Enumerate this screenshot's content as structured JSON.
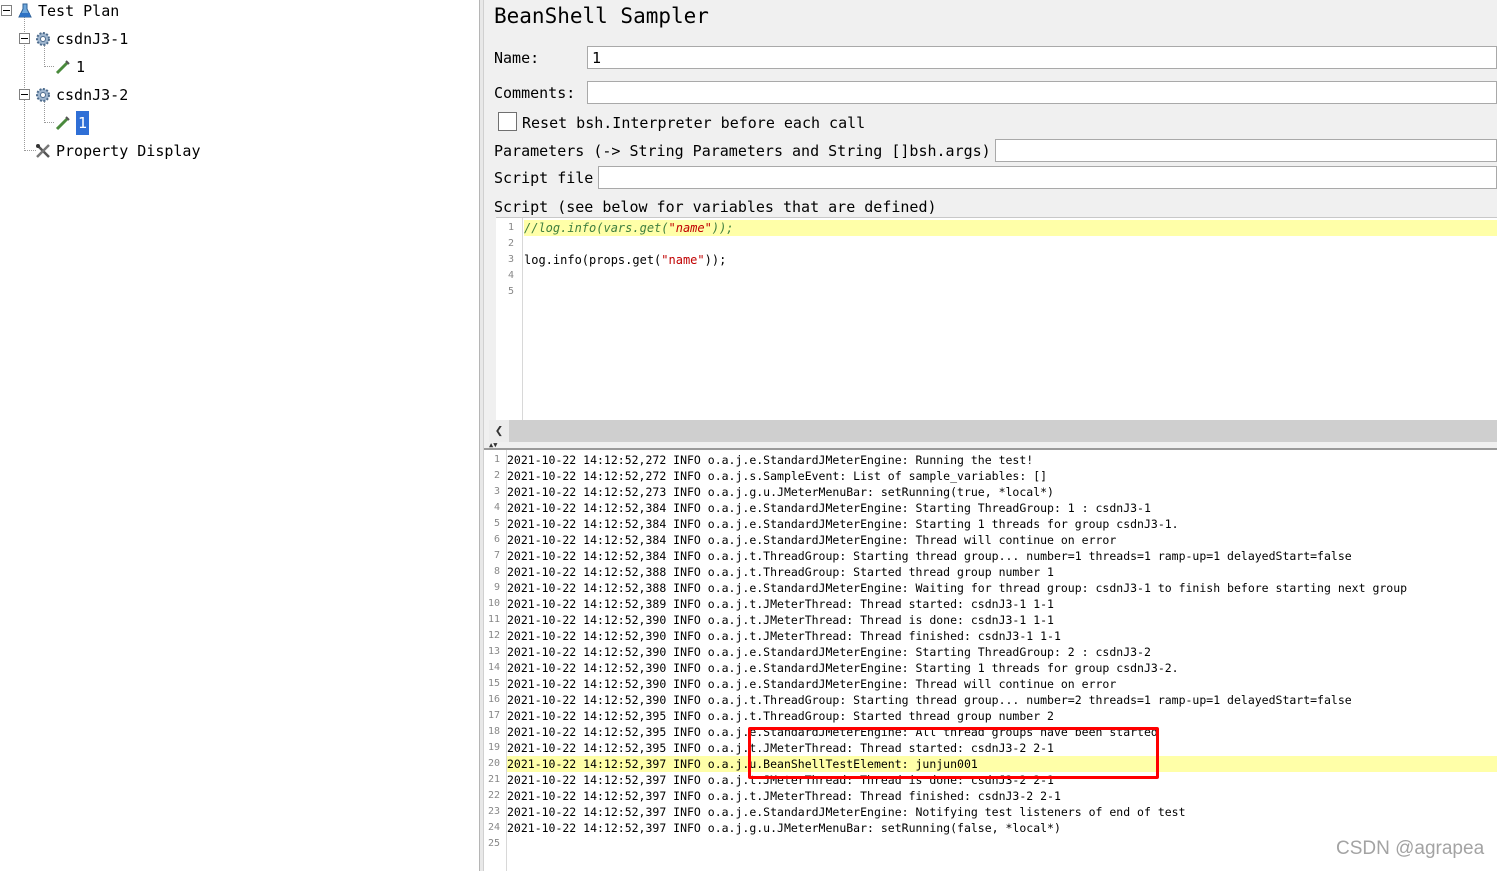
{
  "tree": {
    "nodes": [
      {
        "label": "Test Plan",
        "icon": "test-plan-icon"
      },
      {
        "label": "csdnJ3-1",
        "icon": "thread-group-gear-icon"
      },
      {
        "label": "1",
        "icon": "beanshell-sampler-icon"
      },
      {
        "label": "csdnJ3-2",
        "icon": "thread-group-gear-icon"
      },
      {
        "label": "1",
        "icon": "beanshell-sampler-icon"
      },
      {
        "label": "Property Display",
        "icon": "tools-icon"
      }
    ],
    "selected_index": 4
  },
  "editor": {
    "title": "BeanShell Sampler",
    "name_label": "Name:",
    "name_value": "1",
    "comments_label": "Comments:",
    "comments_value": "",
    "reset_label": "Reset bsh.Interpreter before each call",
    "reset_checked": false,
    "parameters_label": "Parameters (-> String Parameters and String []bsh.args)",
    "parameters_value": "",
    "script_file_label": "Script file",
    "script_file_value": "",
    "script_label": "Script (see below for variables that are defined)",
    "script_lines": [
      {
        "n": "1",
        "text": "//log.info(vars.get(\"name\"));"
      },
      {
        "n": "2",
        "text": ""
      },
      {
        "n": "3",
        "text": "log.info(props.get(\"name\"));"
      },
      {
        "n": "4",
        "text": ""
      },
      {
        "n": "5",
        "text": ""
      }
    ]
  },
  "log": {
    "lines": [
      {
        "n": "1",
        "text": "2021-10-22 14:12:52,272 INFO o.a.j.e.StandardJMeterEngine: Running the test!"
      },
      {
        "n": "2",
        "text": "2021-10-22 14:12:52,272 INFO o.a.j.s.SampleEvent: List of sample_variables: []"
      },
      {
        "n": "3",
        "text": "2021-10-22 14:12:52,273 INFO o.a.j.g.u.JMeterMenuBar: setRunning(true, *local*)"
      },
      {
        "n": "4",
        "text": "2021-10-22 14:12:52,384 INFO o.a.j.e.StandardJMeterEngine: Starting ThreadGroup: 1 : csdnJ3-1"
      },
      {
        "n": "5",
        "text": "2021-10-22 14:12:52,384 INFO o.a.j.e.StandardJMeterEngine: Starting 1 threads for group csdnJ3-1."
      },
      {
        "n": "6",
        "text": "2021-10-22 14:12:52,384 INFO o.a.j.e.StandardJMeterEngine: Thread will continue on error"
      },
      {
        "n": "7",
        "text": "2021-10-22 14:12:52,384 INFO o.a.j.t.ThreadGroup: Starting thread group... number=1 threads=1 ramp-up=1 delayedStart=false"
      },
      {
        "n": "8",
        "text": "2021-10-22 14:12:52,388 INFO o.a.j.t.ThreadGroup: Started thread group number 1"
      },
      {
        "n": "9",
        "text": "2021-10-22 14:12:52,388 INFO o.a.j.e.StandardJMeterEngine: Waiting for thread group: csdnJ3-1 to finish before starting next group"
      },
      {
        "n": "10",
        "text": "2021-10-22 14:12:52,389 INFO o.a.j.t.JMeterThread: Thread started: csdnJ3-1 1-1"
      },
      {
        "n": "11",
        "text": "2021-10-22 14:12:52,390 INFO o.a.j.t.JMeterThread: Thread is done: csdnJ3-1 1-1"
      },
      {
        "n": "12",
        "text": "2021-10-22 14:12:52,390 INFO o.a.j.t.JMeterThread: Thread finished: csdnJ3-1 1-1"
      },
      {
        "n": "13",
        "text": "2021-10-22 14:12:52,390 INFO o.a.j.e.StandardJMeterEngine: Starting ThreadGroup: 2 : csdnJ3-2"
      },
      {
        "n": "14",
        "text": "2021-10-22 14:12:52,390 INFO o.a.j.e.StandardJMeterEngine: Starting 1 threads for group csdnJ3-2."
      },
      {
        "n": "15",
        "text": "2021-10-22 14:12:52,390 INFO o.a.j.e.StandardJMeterEngine: Thread will continue on error"
      },
      {
        "n": "16",
        "text": "2021-10-22 14:12:52,390 INFO o.a.j.t.ThreadGroup: Starting thread group... number=2 threads=1 ramp-up=1 delayedStart=false"
      },
      {
        "n": "17",
        "text": "2021-10-22 14:12:52,395 INFO o.a.j.t.ThreadGroup: Started thread group number 2"
      },
      {
        "n": "18",
        "text": "2021-10-22 14:12:52,395 INFO o.a.j.e.StandardJMeterEngine: All thread groups have been started"
      },
      {
        "n": "19",
        "text": "2021-10-22 14:12:52,395 INFO o.a.j.t.JMeterThread: Thread started: csdnJ3-2 2-1"
      },
      {
        "n": "20",
        "text": "2021-10-22 14:12:52,397 INFO o.a.j.u.BeanShellTestElement: junjun001"
      },
      {
        "n": "21",
        "text": "2021-10-22 14:12:52,397 INFO o.a.j.t.JMeterThread: Thread is done: csdnJ3-2 2-1"
      },
      {
        "n": "22",
        "text": "2021-10-22 14:12:52,397 INFO o.a.j.t.JMeterThread: Thread finished: csdnJ3-2 2-1"
      },
      {
        "n": "23",
        "text": "2021-10-22 14:12:52,397 INFO o.a.j.e.StandardJMeterEngine: Notifying test listeners of end of test"
      },
      {
        "n": "24",
        "text": "2021-10-22 14:12:52,397 INFO o.a.j.g.u.JMeterMenuBar: setRunning(false, *local*)"
      },
      {
        "n": "25",
        "text": ""
      }
    ],
    "highlighted_line": "20"
  },
  "watermark": "CSDN @agrapea",
  "colors": {
    "selection": "#2f6fd6",
    "line_highlight": "#ffffa8",
    "annotation_box": "#ff0000",
    "panel_bg": "#f0f0f0"
  }
}
